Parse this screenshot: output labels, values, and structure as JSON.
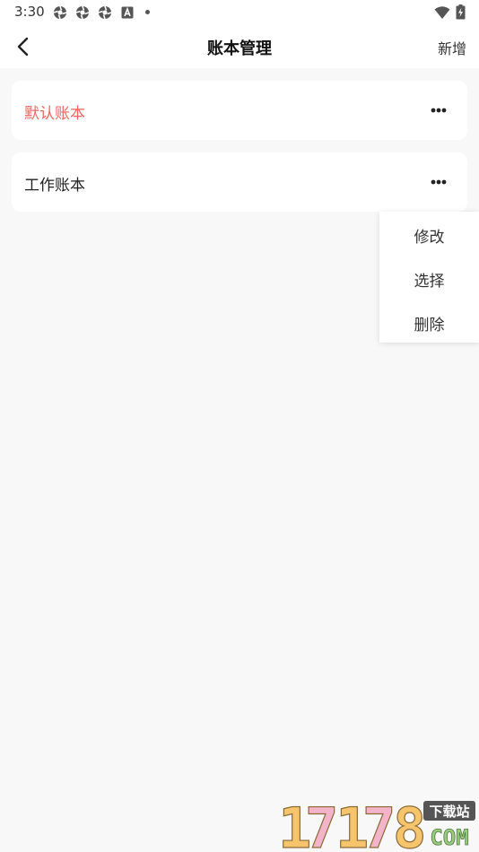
{
  "status_bar": {
    "time": "3:30",
    "icons": [
      "aperture-icon",
      "aperture-icon",
      "aperture-icon",
      "font-a-icon",
      "notification-dot",
      "wifi-icon",
      "battery-charging-icon"
    ]
  },
  "header": {
    "back_icon": "chevron-left-icon",
    "title": "账本管理",
    "add_label": "新增"
  },
  "ledgers": [
    {
      "name": "默认账本",
      "selected": true,
      "color": "#e8685f"
    },
    {
      "name": "工作账本",
      "selected": false,
      "color": "#222222"
    }
  ],
  "more_icon": "ellipsis-icon",
  "popup_menu": {
    "items": [
      "修改",
      "选择",
      "删除"
    ]
  },
  "watermark": {
    "number": "17178",
    "badge": "下载站",
    "domain": "COM",
    "colors": [
      "#f5c46b",
      "#e96f9a",
      "#9acb7e"
    ]
  }
}
